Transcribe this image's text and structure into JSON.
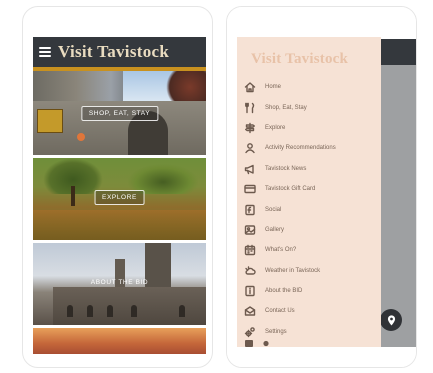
{
  "home": {
    "app_title": "Visit Tavistock",
    "tiles": [
      {
        "label": "SHOP, EAT, STAY"
      },
      {
        "label": "EXPLORE"
      },
      {
        "label": "ABOUT THE BID"
      },
      {
        "label": ""
      }
    ]
  },
  "drawer": {
    "title": "Visit Tavistock",
    "items": [
      {
        "label": "Home",
        "icon": "home-icon"
      },
      {
        "label": "Shop, Eat, Stay",
        "icon": "fork-knife-icon"
      },
      {
        "label": "Explore",
        "icon": "signpost-icon"
      },
      {
        "label": "Activity Recommendations",
        "icon": "person-icon"
      },
      {
        "label": "Tavistock News",
        "icon": "megaphone-icon"
      },
      {
        "label": "Tavistock Gift Card",
        "icon": "card-icon"
      },
      {
        "label": "Social",
        "icon": "share-icon"
      },
      {
        "label": "Gallery",
        "icon": "gallery-icon"
      },
      {
        "label": "What's On?",
        "icon": "calendar-icon"
      },
      {
        "label": "Weather in Tavistock",
        "icon": "weather-icon"
      },
      {
        "label": "About the BID",
        "icon": "info-icon"
      },
      {
        "label": "Contact Us",
        "icon": "envelope-icon"
      },
      {
        "label": "Settings",
        "icon": "gear-icon"
      }
    ]
  },
  "colors": {
    "header_bg": "#34383d",
    "accent_gold": "#c8911f",
    "drawer_bg": "#f6e2d5",
    "drawer_title": "#e8c2a8",
    "menu_text": "#7a6658"
  }
}
